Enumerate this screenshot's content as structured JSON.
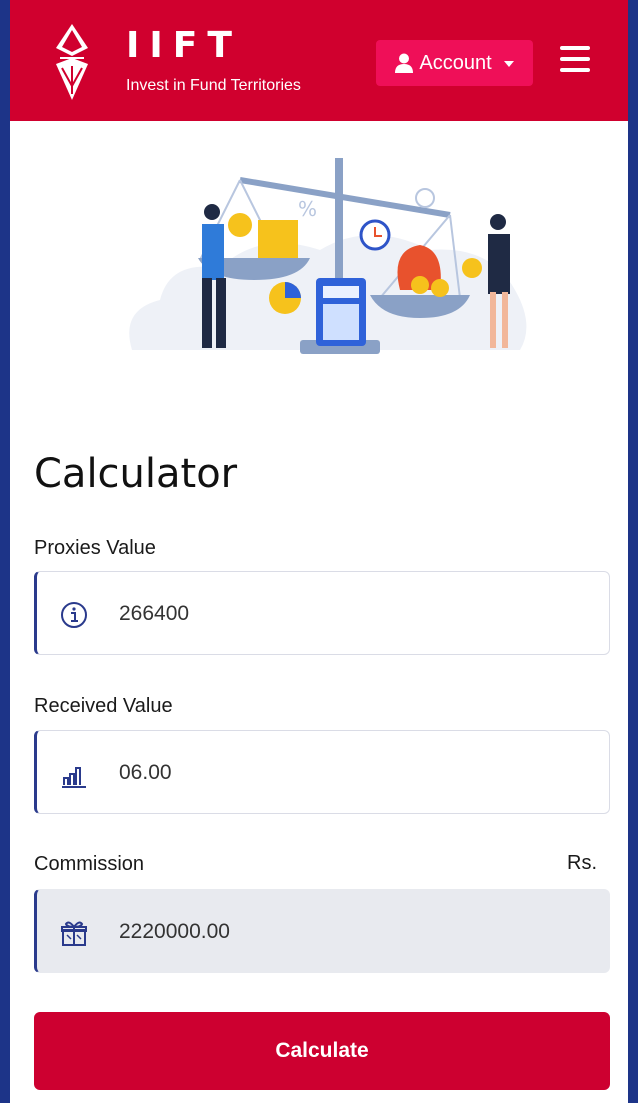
{
  "header": {
    "brand_name": "IIFT",
    "tagline": "Invest in Fund Territories",
    "account_label": "Account",
    "colors": {
      "brand_red": "#d0002e",
      "account_pink": "#ef0f58"
    }
  },
  "page": {
    "title": "Calculator"
  },
  "form": {
    "proxies_label": "Proxies Value",
    "proxies_value": "266400",
    "received_label": "Received Value",
    "received_value": "06.00",
    "commission_label": "Commission",
    "commission_currency": "Rs.",
    "commission_value": "2220000.00",
    "calculate_label": "Calculate"
  },
  "icons": [
    "logo-icon",
    "user-icon",
    "caret-down-icon",
    "hamburger-menu-icon",
    "info-icon",
    "bar-chart-icon",
    "gift-icon"
  ]
}
